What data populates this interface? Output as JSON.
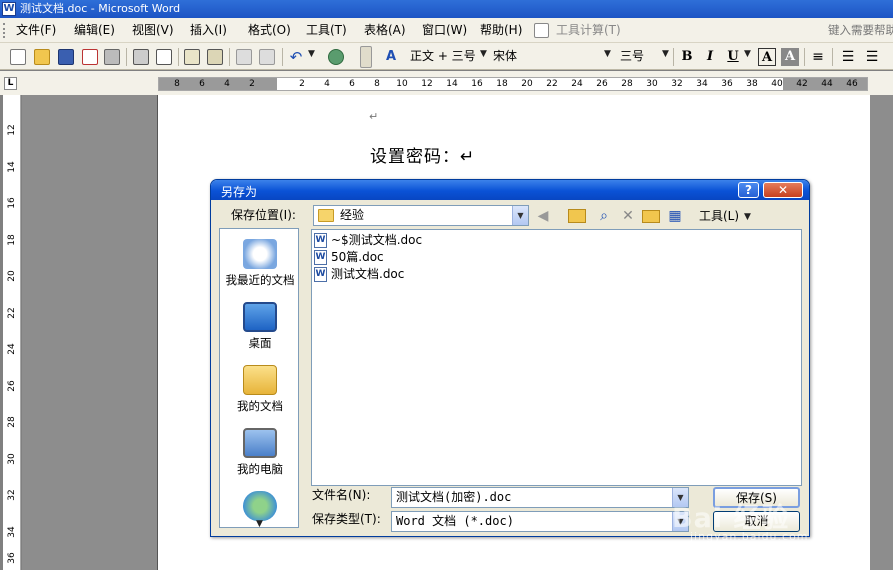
{
  "window": {
    "title": "测试文档.doc - Microsoft Word"
  },
  "menu": {
    "items": [
      "文件(F)",
      "编辑(E)",
      "视图(V)",
      "插入(I)",
      "格式(O)",
      "工具(T)",
      "表格(A)",
      "窗口(W)",
      "帮助(H)",
      "工具计算(T)"
    ],
    "help_search_placeholder": "键入需要帮助"
  },
  "toolbar": {
    "style": "正文 + 三号",
    "font": "宋体",
    "size": "三号",
    "bold": "B",
    "italic": "I",
    "underline": "U",
    "font_color": "A",
    "highlight": "A"
  },
  "ruler": {
    "horizontal_ticks": [
      "8",
      "6",
      "4",
      "2",
      "2",
      "4",
      "6",
      "8",
      "10",
      "12",
      "14",
      "16",
      "18",
      "20",
      "22",
      "24",
      "26",
      "28",
      "30",
      "32",
      "34",
      "36",
      "38",
      "40",
      "42",
      "44",
      "46"
    ],
    "vertical_ticks": [
      "12",
      "14",
      "16",
      "18",
      "20",
      "22",
      "24",
      "26",
      "28",
      "30",
      "32",
      "34",
      "36"
    ]
  },
  "document": {
    "para_mark": "↵",
    "text": "设置密码：↵"
  },
  "dialog": {
    "title": "另存为",
    "save_in_label": "保存位置(I):",
    "save_in_value": "经验",
    "tools_label": "工具(L)",
    "places": [
      "我最近的文档",
      "桌面",
      "我的文档",
      "我的电脑"
    ],
    "files": [
      "~$测试文档.doc",
      "50篇.doc",
      "测试文档.doc"
    ],
    "filename_label": "文件名(N):",
    "filename_value": "测试文档(加密).doc",
    "filetype_label": "保存类型(T):",
    "filetype_value": "Word 文档 (*.doc)",
    "save_button": "保存(S)",
    "cancel_button": "取消"
  },
  "watermark": {
    "main": "Bai 经验",
    "sub": "jingyan.baidu.com"
  }
}
